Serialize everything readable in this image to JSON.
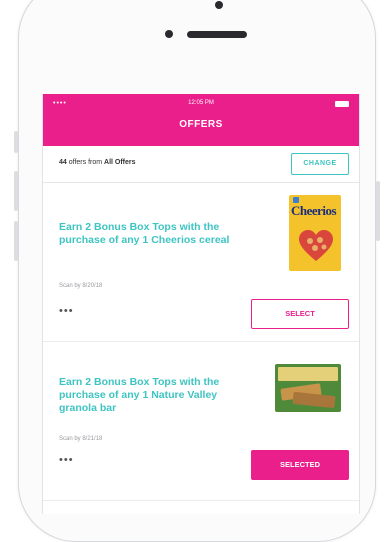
{
  "status_bar": {
    "signal": "••••",
    "time": "12:05 PM"
  },
  "header": {
    "title": "OFFERS"
  },
  "filter": {
    "count": "44",
    "text_middle": " offers from ",
    "source": "All Offers",
    "change_label": "CHANGE"
  },
  "offers": [
    {
      "description": "Earn 2 Bonus Box Tops with the purchase of any 1 Cheerios cereal",
      "scan_by": "Scan by 8/20/18",
      "more": "•••",
      "button_label": "SELECT",
      "button_state": "unselected",
      "product_brand": "Cheerios",
      "product_icon": "cheerios-cereal-box"
    },
    {
      "description": "Earn 2 Bonus Box Tops with the purchase of any 1 Nature Valley granola bar",
      "scan_by": "Scan by 8/21/18",
      "more": "•••",
      "button_label": "SELECTED",
      "button_state": "selected",
      "product_icon": "nature-valley-granola-box"
    }
  ],
  "colors": {
    "accent_pink": "#ea1f8c",
    "accent_teal": "#3ec4c2"
  }
}
